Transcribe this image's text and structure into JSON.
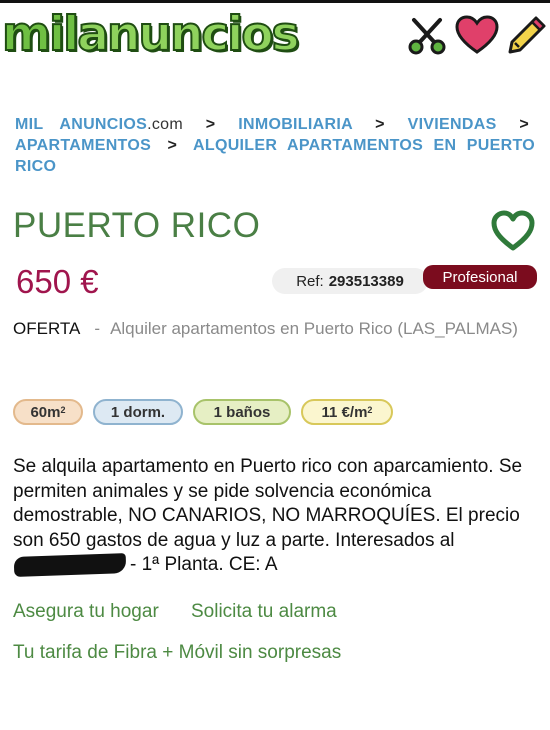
{
  "header": {
    "logo_part1": "mil",
    "logo_part2": "anuncios",
    "icons": [
      "scissors-icon",
      "heart-icon",
      "pencil-icon"
    ]
  },
  "breadcrumb": {
    "site": "MIL ANUNCIOS",
    "site_suffix": ".com",
    "items": [
      "INMOBILIARIA",
      "VIVIENDAS",
      "APARTAMENTOS",
      "ALQUILER APARTAMENTOS EN PUERTO RICO"
    ],
    "separator": ">"
  },
  "listing": {
    "title": "PUERTO RICO",
    "price": "650 €",
    "ref_label": "Ref:",
    "ref_value": "293513389",
    "badge": "Profesional",
    "offer_label": "OFERTA",
    "offer_dash": "-",
    "offer_text": "Alquiler apartamentos en Puerto Rico (LAS_PALMAS)",
    "features": {
      "area": "60m",
      "area_sup": "2",
      "bedrooms": "1 dorm.",
      "bathrooms": "1 baños",
      "price_per_m2": "11 €/m",
      "price_per_m2_sup": "2"
    },
    "description_part1": "Se alquila apartamento en Puerto rico con aparcamiento. Se permiten animales y se pide solvencia económica demostrable, NO CANARIOS, NO MARROQUÍES. El precio son 650 gastos de agua y luz a parte. Interesados al",
    "description_part2": "- 1ª Planta. CE: A"
  },
  "links": {
    "insurance": "Asegura tu hogar",
    "alarm": "Solicita tu alarma",
    "fiber": "Tu tarifa de Fibra + Móvil sin sorpresas"
  },
  "colors": {
    "brand_green": "#6fbf43",
    "title_green": "#4a7f45",
    "price": "#a0154d",
    "badge": "#7b0c1e",
    "breadcrumb": "#4b95c8",
    "pill_area": "#f4d7b6",
    "pill_dorm": "#c5d9ea",
    "pill_banos": "#d8e8a6",
    "pill_m2": "#f2ea9a"
  }
}
